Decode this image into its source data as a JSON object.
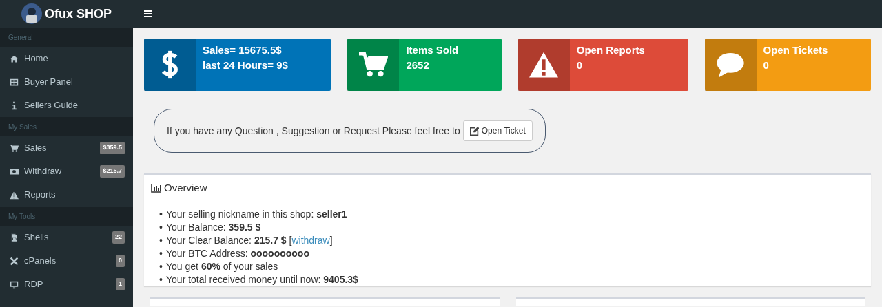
{
  "brand": {
    "title": "Ofux SHOP"
  },
  "sidebar": {
    "sections": [
      {
        "heading": "General",
        "items": [
          {
            "label": "Home",
            "kind": "home"
          },
          {
            "label": "Buyer Panel",
            "kind": "grid"
          },
          {
            "label": "Sellers Guide",
            "kind": "info"
          }
        ]
      },
      {
        "heading": "My Sales",
        "items": [
          {
            "label": "Sales",
            "kind": "cart",
            "badge": "$359.5"
          },
          {
            "label": "Withdraw",
            "kind": "money",
            "badge": "$215.7"
          },
          {
            "label": "Reports",
            "kind": "warning"
          }
        ]
      },
      {
        "heading": "My Tools",
        "items": [
          {
            "label": "Shells",
            "kind": "file",
            "badge": "22"
          },
          {
            "label": "cPanels",
            "kind": "tools",
            "badge": "0"
          },
          {
            "label": "RDP",
            "kind": "monitor",
            "badge": "1"
          }
        ]
      }
    ]
  },
  "stats": [
    {
      "kind": "dollar",
      "color": "#0073b7",
      "lines": [
        "Sales= 15675.5$",
        "last 24 Hours= 9$"
      ]
    },
    {
      "kind": "cart",
      "color": "#00a65a",
      "lines": [
        "Items Sold",
        "2652"
      ]
    },
    {
      "kind": "warning",
      "color": "#dd4b39",
      "lines": [
        "Open Reports",
        "0"
      ]
    },
    {
      "kind": "chat",
      "color": "#f39c12",
      "lines": [
        "Open Tickets",
        "0"
      ]
    }
  ],
  "notice": {
    "text": "If you have any Question , Suggestion or Request Please feel free to",
    "button": "Open Ticket"
  },
  "overview": {
    "title": "Overview",
    "items": [
      {
        "bullet": "•",
        "text": "Your selling nickname in this shop: **seller1**"
      },
      {
        "bullet": "•",
        "text": "Your Balance: **359.5 $**"
      },
      {
        "bullet": "•",
        "text": "Your Clear Balance: **215.7 $** [",
        "link": "withdraw",
        "after": "]"
      },
      {
        "bullet": "•",
        "text": "Your BTC Address: **oooooooooo**"
      },
      {
        "bullet": "•",
        "text": "You get **60%** of your sales"
      },
      {
        "bullet": "•",
        "text": "Your total received money until now: **9405.3$**"
      }
    ]
  }
}
